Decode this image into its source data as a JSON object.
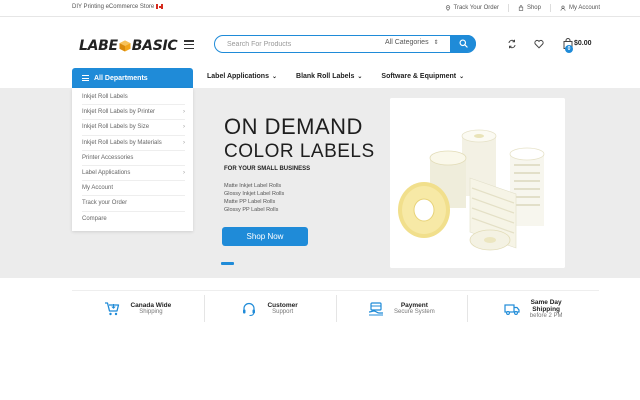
{
  "topbar": {
    "store_text": "DIY Printing eCommerce Store",
    "links": [
      "Track Your Order",
      "Shop",
      "My Account"
    ]
  },
  "header": {
    "logo_left": "LABE",
    "logo_right": "BASIC",
    "search_placeholder": "Search For Products",
    "category_selected": "All Categories",
    "cart_count": "0",
    "cart_total": "$0.00"
  },
  "nav": {
    "departments_label": "All Departments",
    "menu": [
      "Label Applications",
      "Blank Roll Labels",
      "Software & Equipment"
    ]
  },
  "sidebar": {
    "items": [
      {
        "label": "Inkjet Roll Labels",
        "chevron": ""
      },
      {
        "label": "Inkjet Roll Labels by Printer",
        "chevron": "›"
      },
      {
        "label": "Inkjet Roll Labels by Size",
        "chevron": "›"
      },
      {
        "label": "Inkjet Roll Labels by Materials",
        "chevron": "›"
      },
      {
        "label": "Printer Accessories",
        "chevron": ""
      },
      {
        "label": "Label Applications",
        "chevron": "›"
      },
      {
        "label": "My Account",
        "chevron": ""
      },
      {
        "label": "Track your Order",
        "chevron": ""
      },
      {
        "label": "Compare",
        "chevron": ""
      }
    ]
  },
  "hero": {
    "title_line1": "ON DEMAND",
    "title_line2": "COLOR LABELS",
    "subtitle": "FOR YOUR SMALL BUSINESS",
    "list": [
      "Matte Inkjet Label Rolls",
      "Glossy Inkjet Label Rolls",
      "Matte PP Label Rolls",
      "Glossy PP Label Rolls"
    ],
    "button": "Shop Now"
  },
  "features": [
    {
      "title": "Canada Wide",
      "sub": "Shipping",
      "icon": "cart-icon"
    },
    {
      "title": "Customer",
      "sub": "Support",
      "icon": "headset-icon"
    },
    {
      "title": "Payment",
      "sub": "Secure System",
      "icon": "secure-payment-icon"
    },
    {
      "title": "Same Day",
      "title2": "Shipping",
      "sub": "before 2 PM",
      "icon": "truck-icon"
    }
  ],
  "colors": {
    "accent": "#1f8bd8",
    "logo_cube": "#f2a51a",
    "hero_bg": "#ececec"
  }
}
